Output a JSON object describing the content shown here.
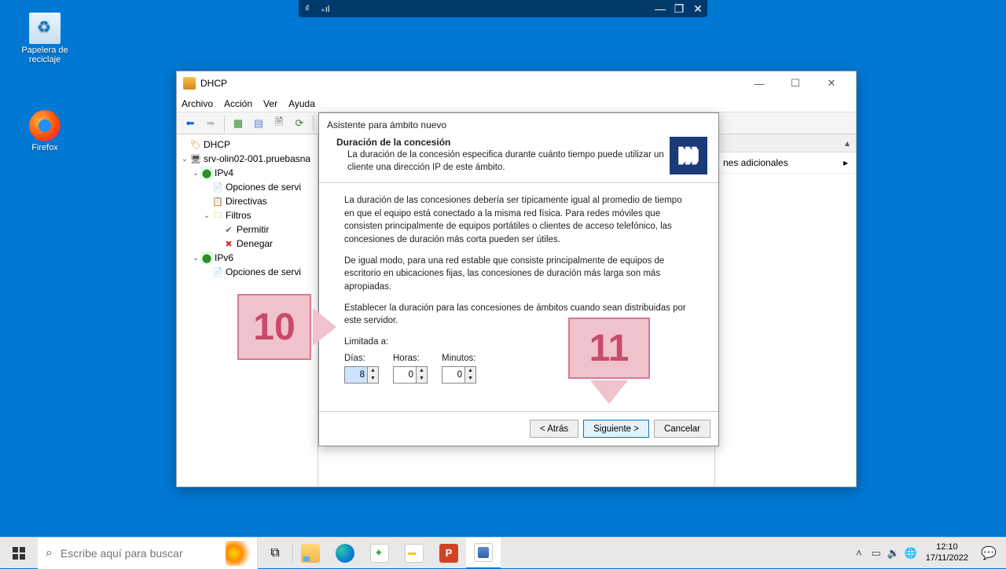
{
  "desktop": {
    "recycle": "Papelera de\nreciclaje",
    "firefox": "Firefox"
  },
  "remotebar": {
    "min": "—",
    "restore": "❐",
    "close": "✕"
  },
  "mmc": {
    "title": "DHCP",
    "menu": {
      "file": "Archivo",
      "action": "Acción",
      "view": "Ver",
      "help": "Ayuda"
    },
    "tree": {
      "root": "DHCP",
      "server": "srv-olin02-001.pruebasna",
      "ipv4": "IPv4",
      "serveropts": "Opciones de servi",
      "policies": "Directivas",
      "filters": "Filtros",
      "allow": "Permitir",
      "deny": "Denegar",
      "ipv6": "IPv6",
      "serveropts6": "Opciones de servi"
    },
    "actions": {
      "additional": "nes adicionales"
    }
  },
  "wizard": {
    "title": "Asistente para ámbito nuevo",
    "heading": "Duración de la concesión",
    "subheading": "La duración de la concesión especifica durante cuánto tiempo puede utilizar un cliente una dirección IP de este ámbito.",
    "para1": "La duración de las concesiones debería ser típicamente igual al promedio de tiempo en que el equipo está conectado a la misma red física. Para redes móviles que consisten principalmente de equipos portátiles o clientes de acceso telefónico, las concesiones de duración más corta pueden ser útiles.",
    "para2": "De igual modo, para una red estable que consiste principalmente de equipos de escritorio en ubicaciones fijas, las concesiones de duración más larga son más apropiadas.",
    "para3": "Establecer la duración para las concesiones de ámbitos cuando sean distribuidas por este servidor.",
    "limited": "Limitada a:",
    "days_label": "Días:",
    "hours_label": "Horas:",
    "minutes_label": "Minutos:",
    "days": "8",
    "hours": "0",
    "minutes": "0",
    "back": "< Atrás",
    "next": "Siguiente >",
    "cancel": "Cancelar"
  },
  "callouts": {
    "c10": "10",
    "c11": "11"
  },
  "taskbar": {
    "search_placeholder": "Escribe aquí para buscar",
    "time": "12:10",
    "date": "17/11/2022"
  }
}
